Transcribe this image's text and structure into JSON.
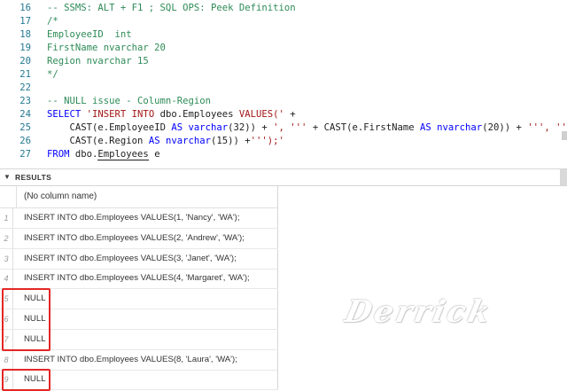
{
  "editor": {
    "lines": [
      {
        "num": "16",
        "tokens": [
          {
            "t": "-- SSMS: ALT + F1 ; SQL OPS: Peek Definition",
            "k": "comment"
          }
        ]
      },
      {
        "num": "17",
        "tokens": [
          {
            "t": "/*",
            "k": "comment"
          }
        ]
      },
      {
        "num": "18",
        "tokens": [
          {
            "t": "EmployeeID  int",
            "k": "comment"
          }
        ]
      },
      {
        "num": "19",
        "tokens": [
          {
            "t": "FirstName nvarchar 20",
            "k": "comment"
          }
        ]
      },
      {
        "num": "20",
        "tokens": [
          {
            "t": "Region nvarchar 15",
            "k": "comment"
          }
        ]
      },
      {
        "num": "21",
        "tokens": [
          {
            "t": "*/",
            "k": "comment"
          }
        ]
      },
      {
        "num": "22",
        "tokens": []
      },
      {
        "num": "23",
        "tokens": [
          {
            "t": "-- NULL issue - Column-Region",
            "k": "comment"
          }
        ]
      },
      {
        "num": "24",
        "tokens": [
          {
            "t": "SELECT ",
            "k": "keyword"
          },
          {
            "t": "'INSERT INTO ",
            "k": "string"
          },
          {
            "t": "dbo.Employees",
            "k": "plain"
          },
          {
            "t": " VALUES(' ",
            "k": "string"
          },
          {
            "t": "+",
            "k": "plain"
          }
        ]
      },
      {
        "num": "25",
        "tokens": [
          {
            "t": "    CAST",
            "k": "plain"
          },
          {
            "t": "(e.EmployeeID ",
            "k": "plain"
          },
          {
            "t": "AS ",
            "k": "keyword"
          },
          {
            "t": "varchar",
            "k": "keyword"
          },
          {
            "t": "(32)) + ",
            "k": "plain"
          },
          {
            "t": "', '''",
            "k": "string"
          },
          {
            "t": " + ",
            "k": "plain"
          },
          {
            "t": "CAST",
            "k": "plain"
          },
          {
            "t": "(e.FirstName ",
            "k": "plain"
          },
          {
            "t": "AS ",
            "k": "keyword"
          },
          {
            "t": "nvarchar",
            "k": "keyword"
          },
          {
            "t": "(20)) + ",
            "k": "plain"
          },
          {
            "t": "''', '''",
            "k": "string"
          },
          {
            "t": " +",
            "k": "plain"
          }
        ]
      },
      {
        "num": "26",
        "tokens": [
          {
            "t": "    CAST",
            "k": "plain"
          },
          {
            "t": "(e.Region ",
            "k": "plain"
          },
          {
            "t": "AS ",
            "k": "keyword"
          },
          {
            "t": "nvarchar",
            "k": "keyword"
          },
          {
            "t": "(15)) +",
            "k": "plain"
          },
          {
            "t": "''');'",
            "k": "string"
          }
        ]
      },
      {
        "num": "27",
        "tokens": [
          {
            "t": "FROM ",
            "k": "keyword"
          },
          {
            "t": "dbo.",
            "k": "plain"
          },
          {
            "t": "Employees",
            "k": "link"
          },
          {
            "t": " e",
            "k": "plain"
          }
        ]
      }
    ]
  },
  "results": {
    "toggle_icon": "chevron-down-icon",
    "title": "RESULTS",
    "column_header": "(No column name)",
    "rows": [
      {
        "num": "1",
        "value": "INSERT INTO dbo.Employees VALUES(1, 'Nancy', 'WA');"
      },
      {
        "num": "2",
        "value": "INSERT INTO dbo.Employees VALUES(2, 'Andrew', 'WA');"
      },
      {
        "num": "3",
        "value": "INSERT INTO dbo.Employees VALUES(3, 'Janet', 'WA');"
      },
      {
        "num": "4",
        "value": "INSERT INTO dbo.Employees VALUES(4, 'Margaret', 'WA');"
      },
      {
        "num": "5",
        "value": "NULL",
        "highlighted": true
      },
      {
        "num": "6",
        "value": "NULL",
        "highlighted": true
      },
      {
        "num": "7",
        "value": "NULL",
        "highlighted": true
      },
      {
        "num": "8",
        "value": "INSERT INTO dbo.Employees VALUES(8, 'Laura', 'WA');"
      },
      {
        "num": "9",
        "value": "NULL",
        "highlighted": true
      }
    ]
  },
  "watermark": "Derrick",
  "colors": {
    "keyword": "#0000ff",
    "string": "#a31515",
    "comment": "#2e8b57",
    "line_number": "#237893",
    "highlight_box": "#e32626"
  }
}
